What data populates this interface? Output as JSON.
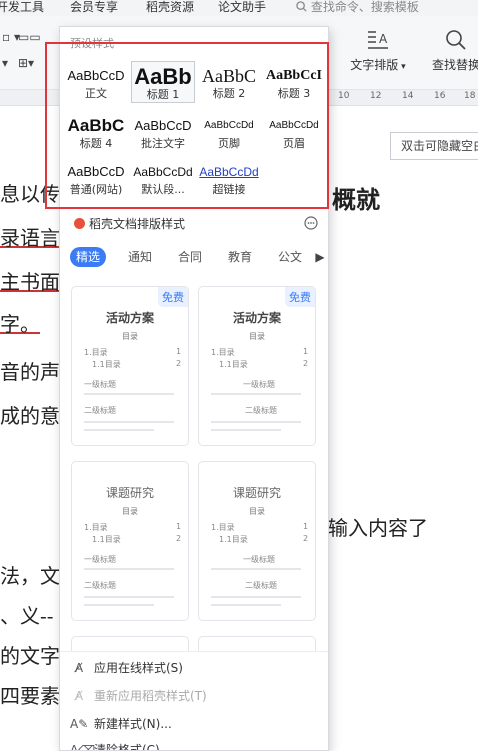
{
  "menubar": {
    "items": [
      "开发工具",
      "会员专享",
      "稻壳资源",
      "论文助手"
    ],
    "search_placeholder": "查找命令、搜索模板"
  },
  "ribbon": {
    "text_layout_label": "文字排版",
    "find_replace_label": "查找替换"
  },
  "ruler": {
    "marks": [
      "10",
      "12",
      "14",
      "16",
      "18"
    ]
  },
  "document": {
    "lines": [
      "息以传",
      "录语言",
      "主书面",
      "字。",
      "音的声",
      "成的意",
      "法，文",
      "、义--",
      "的文字",
      "四要素"
    ],
    "bold_right": "概就",
    "right_text": "输入内容了",
    "hide_blank_button": "双击可隐藏空白"
  },
  "style_panel": {
    "preset_header": "预设样式",
    "presets": [
      {
        "sample": "AaBbCcD",
        "name": "正文"
      },
      {
        "sample": "AaBb",
        "name": "标题 1"
      },
      {
        "sample": "AaBbC",
        "name": "标题 2"
      },
      {
        "sample": "AaBbCcI",
        "name": "标题 3"
      },
      {
        "sample": "AaBbC",
        "name": "标题 4"
      },
      {
        "sample": "AaBbCcD",
        "name": "批注文字"
      },
      {
        "sample": "AaBbCcDd",
        "name": "页脚"
      },
      {
        "sample": "AaBbCcDd",
        "name": "页眉"
      },
      {
        "sample": "AaBbCcD",
        "name": "普通(网站)"
      },
      {
        "sample": "AaBbCcDd",
        "name": "默认段..."
      },
      {
        "sample": "AaBbCcDd",
        "name": "超链接"
      }
    ],
    "section_title": "稻壳文档排版样式",
    "tabs": [
      "精选",
      "通知",
      "合同",
      "教育",
      "公文"
    ],
    "cards": [
      {
        "title": "活动方案",
        "badge": "免费",
        "toc": "目录",
        "row1": "1.目录",
        "row2": "1.1目录",
        "n1": "1",
        "n2": "2",
        "h1": "一级标题",
        "h2": "二级标题"
      },
      {
        "title": "活动方案",
        "badge": "免费",
        "toc": "目录",
        "row1": "1.目录",
        "row2": "1.1目录",
        "n1": "1",
        "n2": "2",
        "h1": "一级标题",
        "h2": "二级标题"
      },
      {
        "title": "课题研究",
        "toc": "目录",
        "row1": "1.目录",
        "row2": "1.1目录",
        "n1": "1",
        "n2": "2",
        "h1": "一级标题",
        "h2": "二级标题"
      },
      {
        "title": "课题研究",
        "toc": "目录",
        "row1": "1.目录",
        "row2": "1.1目录",
        "n1": "1",
        "n2": "2",
        "h1": "一级标题",
        "h2": "二级标题"
      }
    ],
    "actions": [
      {
        "label": "应用在线样式(S)",
        "icon": "apply-style-icon"
      },
      {
        "label": "重新应用稻壳样式(T)",
        "icon": "reapply-style-icon"
      },
      {
        "label": "新建样式(N)...",
        "icon": "new-style-icon"
      },
      {
        "label": "清除格式(C)",
        "icon": "clear-format-icon"
      }
    ]
  },
  "colors": {
    "accent": "#3b7cf6",
    "highlight_box": "#e0363b",
    "link": "#1f3fbf"
  }
}
